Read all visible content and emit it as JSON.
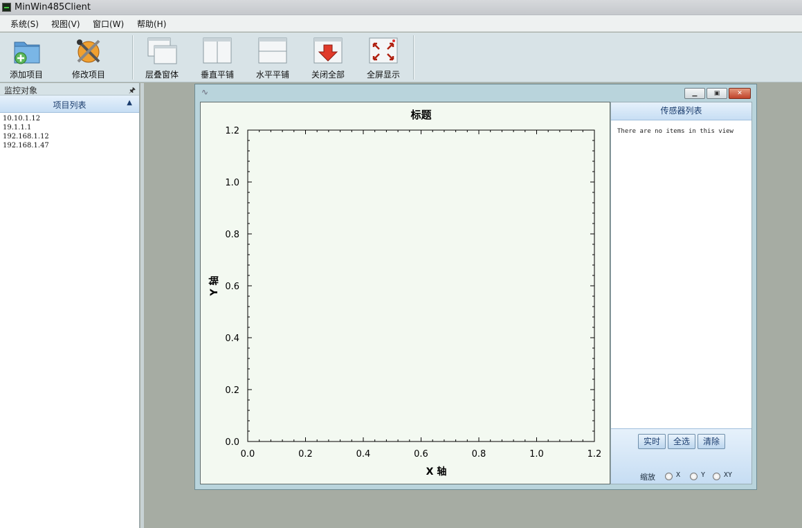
{
  "window": {
    "title": "MinWin485Client"
  },
  "menu": [
    "系统(S)",
    "视图(V)",
    "窗口(W)",
    "帮助(H)"
  ],
  "toolbar": {
    "add_item": "添加项目",
    "edit_item": "修改项目",
    "cascade": "层叠窗体",
    "tile_vertical": "垂直平铺",
    "tile_horizontal": "水平平铺",
    "close_all": "关闭全部",
    "fullscreen": "全屏显示"
  },
  "left_panel": {
    "title": "监控对象",
    "pin_icon": "pin-icon",
    "list_header": "项目列表",
    "items": [
      "10.10.1.12",
      "19.1.1.1",
      "192.168.1.12",
      "192.168.1.47"
    ]
  },
  "sensor_panel": {
    "title": "传感器列表",
    "empty_text": "There are no items in this view",
    "buttons": {
      "realtime": "实时",
      "select_all": "全选",
      "clear": "清除"
    },
    "zoom": {
      "label": "缩放",
      "options": [
        "X",
        "Y",
        "XY"
      ]
    }
  },
  "chart_data": {
    "type": "line",
    "title": "标题",
    "xlabel": "X 轴",
    "ylabel": "Y 轴",
    "xlim": [
      0.0,
      1.2
    ],
    "ylim": [
      0.0,
      1.2
    ],
    "xticks": [
      "0.0",
      "0.2",
      "0.4",
      "0.6",
      "0.8",
      "1.0",
      "1.2"
    ],
    "yticks": [
      "0.0",
      "0.2",
      "0.4",
      "0.6",
      "0.8",
      "1.0",
      "1.2"
    ],
    "series": [],
    "grid": false
  },
  "colors": {
    "chart_bg": "#f3f9f1",
    "workspace": "#a6aca3",
    "toolbar": "#d8e3e7",
    "accent": "#1a3c6e"
  }
}
